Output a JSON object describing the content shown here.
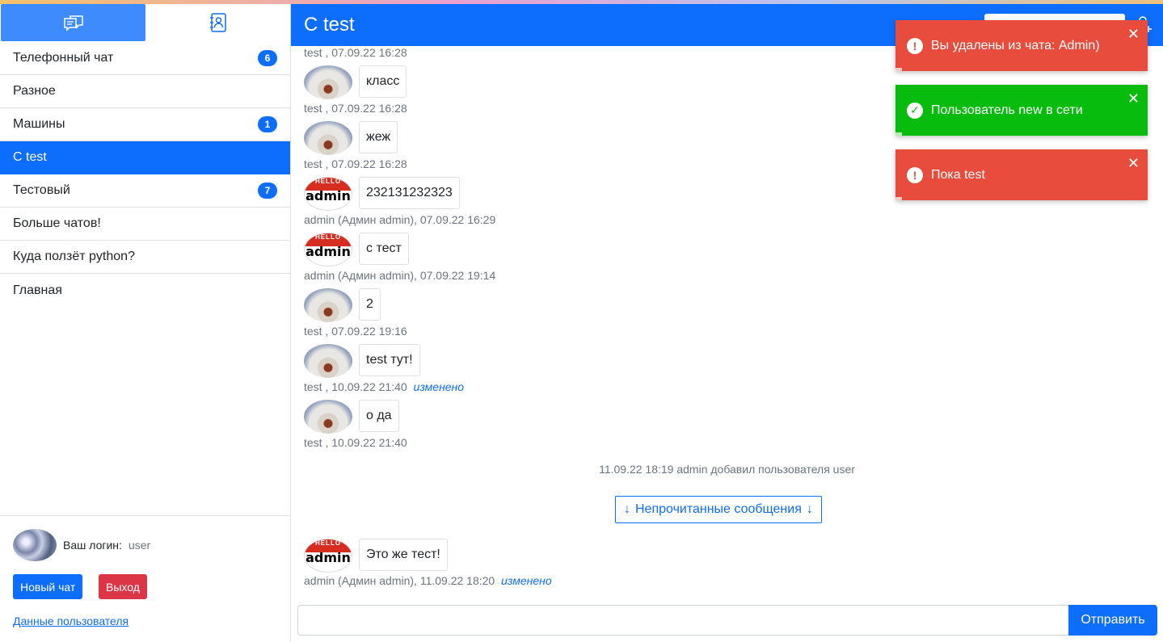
{
  "sidebar": {
    "chats": [
      {
        "name": "Телефонный чат",
        "badge": "6"
      },
      {
        "name": "Разное",
        "badge": ""
      },
      {
        "name": "Машины",
        "badge": "1"
      },
      {
        "name": "С test",
        "badge": "",
        "active": true
      },
      {
        "name": "Тестовый",
        "badge": "7"
      },
      {
        "name": "Больше чатов!",
        "badge": ""
      },
      {
        "name": "Куда ползёт python?",
        "badge": ""
      },
      {
        "name": "Главная",
        "badge": ""
      }
    ],
    "login_label": "Ваш логин:",
    "login_value": "user",
    "new_chat_label": "Новый чат",
    "logout_label": "Выход",
    "user_data_link": "Данные пользователя"
  },
  "header": {
    "title": "С test"
  },
  "messages": {
    "top_meta": "test , 07.09.22 16:28",
    "items": [
      {
        "avatar": "test",
        "text": "класс",
        "meta": "test , 07.09.22 16:28",
        "edited": ""
      },
      {
        "avatar": "test",
        "text": "жеж",
        "meta": "test , 07.09.22 16:28",
        "edited": ""
      },
      {
        "avatar": "admin",
        "text": "232131232323",
        "meta": "admin (Админ admin), 07.09.22 16:29",
        "edited": ""
      },
      {
        "avatar": "admin",
        "text": "с тест",
        "meta": "admin (Админ admin), 07.09.22 19:14",
        "edited": ""
      },
      {
        "avatar": "test",
        "text": "2",
        "meta": "test , 07.09.22 19:16",
        "edited": ""
      },
      {
        "avatar": "test",
        "text": "test тут!",
        "meta": "test , 10.09.22 21:40",
        "edited": "изменено"
      },
      {
        "avatar": "test",
        "text": "о да",
        "meta": "test , 10.09.22 21:40",
        "edited": ""
      }
    ],
    "system_note": "11.09.22 18:19 admin добавил пользователя user",
    "unread_label": "Непрочитанные сообщения",
    "last": {
      "avatar": "admin",
      "text": "Это же тест!",
      "meta": "admin (Админ admin), 11.09.22 18:20",
      "edited": "изменено"
    },
    "admin_badge_top": "HELLO",
    "admin_badge_name": "admin"
  },
  "composer": {
    "send_label": "Отправить",
    "value": ""
  },
  "toasts": [
    {
      "type": "error",
      "text": "Вы удалены из чата: Admin)"
    },
    {
      "type": "success",
      "text": "Пользователь new в сети"
    },
    {
      "type": "error",
      "text": "Пока test"
    }
  ],
  "colors": {
    "primary": "#0d6efd",
    "danger": "#dc3545",
    "toast_error": "#e74c3c",
    "toast_success": "#07bc0c"
  }
}
